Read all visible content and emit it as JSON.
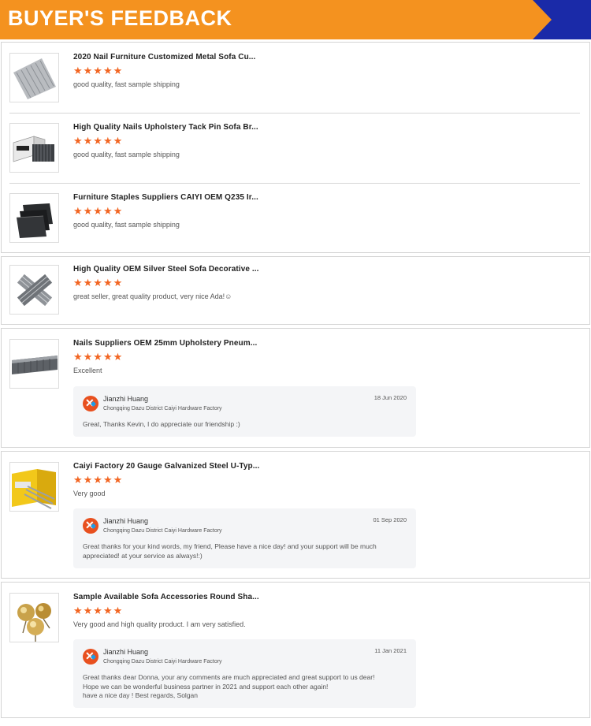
{
  "header": {
    "title": "BUYER'S FEEDBACK"
  },
  "colors": {
    "banner_orange": "#f4921f",
    "banner_blue": "#1a2aa8",
    "star": "#f26522",
    "reply_bg": "#f4f5f7"
  },
  "stars_glyph": "★★★★★",
  "items": [
    {
      "title": "2020 Nail Furniture Customized Metal Sofa Cu...",
      "rating": 5,
      "review": "good quality, fast sample shipping",
      "thumb_icon": "straight-brad-nails-strip"
    },
    {
      "title": "High Quality Nails Upholstery Tack Pin Sofa Br...",
      "rating": 5,
      "review": "good quality, fast sample shipping",
      "thumb_icon": "boxed-staples"
    },
    {
      "title": "Furniture Staples Suppliers CAIYI OEM Q235 Ir...",
      "rating": 5,
      "review": "good quality, fast sample shipping",
      "thumb_icon": "black-staples-stack"
    },
    {
      "title": "High Quality OEM Silver Steel Sofa Decorative ...",
      "rating": 5,
      "review": "great seller, great quality product, very nice Ada!☺",
      "thumb_icon": "crossed-silver-staples"
    },
    {
      "title": "Nails Suppliers OEM 25mm Upholstery Pneum...",
      "rating": 5,
      "review": "Excellent",
      "thumb_icon": "pneumatic-nail-strip",
      "reply": {
        "name": "Jianzhi Huang",
        "company": "Chongqing Dazu District Caiyi Hardware Factory",
        "date": "18 Jun 2020",
        "text": "Great, Thanks Kevin, I do appreciate our friendship :)"
      }
    },
    {
      "title": "Caiyi Factory 20 Gauge Galvanized Steel U-Typ...",
      "rating": 5,
      "review": "Very good",
      "thumb_icon": "yellow-box-u-staples",
      "reply": {
        "name": "Jianzhi Huang",
        "company": "Chongqing Dazu District Caiyi Hardware Factory",
        "date": "01 Sep 2020",
        "text": "Great thanks for your kind words, my friend, Please have a nice day! and your support will be much\nappreciated! at your service as always!:)"
      }
    },
    {
      "title": "Sample Available Sofa Accessories Round Sha...",
      "rating": 5,
      "review": "Very good and high quality product. I am very satisfied.",
      "thumb_icon": "gold-upholstery-tacks",
      "reply": {
        "name": "Jianzhi Huang",
        "company": "Chongqing Dazu District Caiyi Hardware Factory",
        "date": "11 Jan 2021",
        "text": "Great thanks dear Donna, your any comments are much appreciated and great support to us dear!\nHope we can be wonderful business partner in 2021 and support each other again!\nhave a nice day ! Best regards, Solgan"
      }
    }
  ]
}
